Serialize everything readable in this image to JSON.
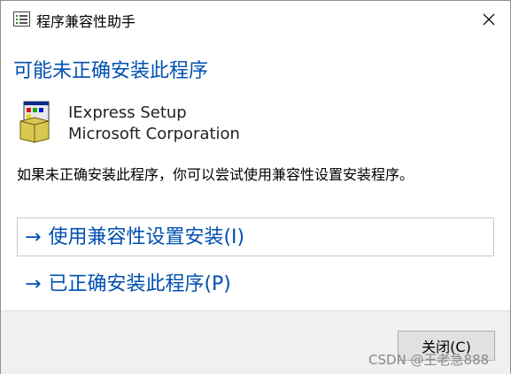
{
  "window": {
    "title": "程序兼容性助手",
    "close_glyph": "✕"
  },
  "content": {
    "heading": "可能未正确安装此程序",
    "app_name": "IExpress Setup",
    "app_publisher": "Microsoft Corporation",
    "description": "如果未正确安装此程序，你可以尝试使用兼容性设置安装程序。",
    "commands": [
      {
        "arrow": "→",
        "label": "使用兼容性设置安装(I)"
      },
      {
        "arrow": "→",
        "label": "已正确安装此程序(P)"
      }
    ]
  },
  "footer": {
    "close_label": "关闭(C)"
  },
  "watermark": "CSDN @王老急888",
  "colors": {
    "accent": "#0050b0",
    "footer_bg": "#f0f0f0"
  }
}
